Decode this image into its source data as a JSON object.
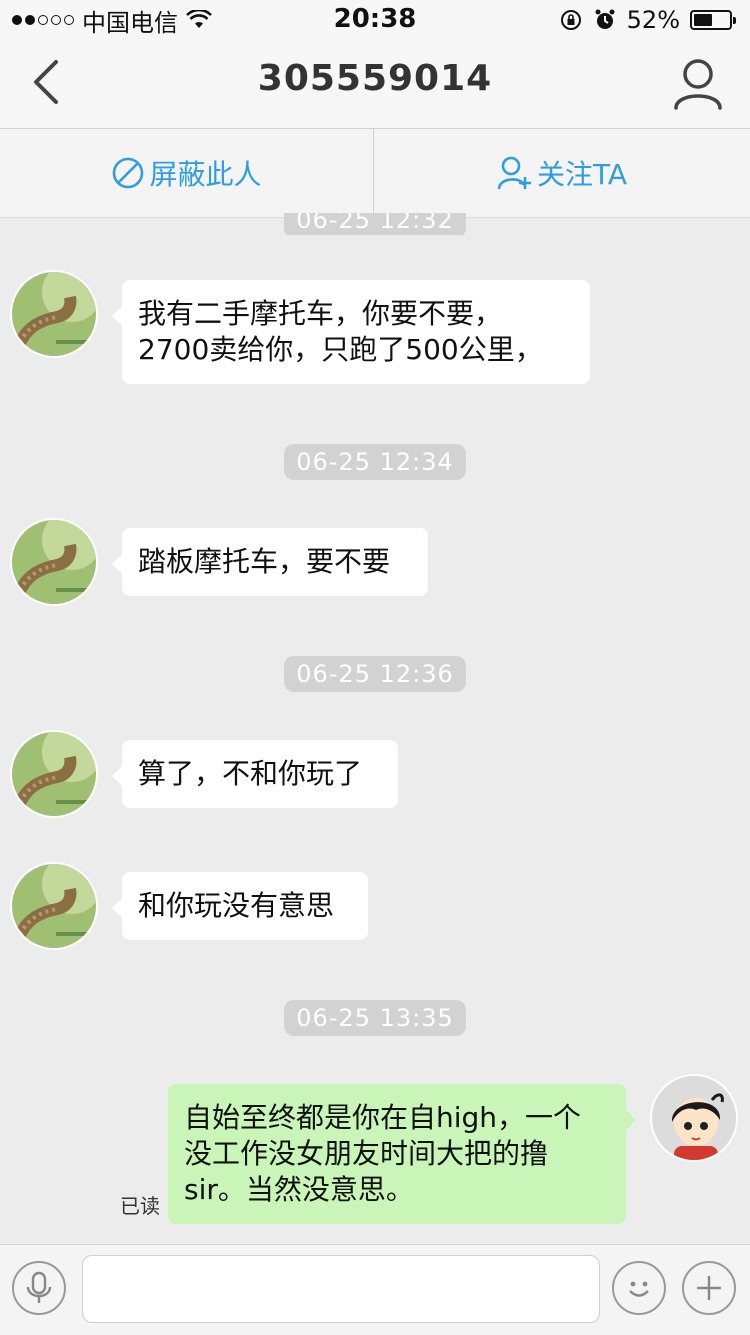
{
  "status_bar": {
    "carrier": "中国电信",
    "time": "20:38",
    "battery": "52%",
    "battery_level": 0.52
  },
  "nav": {
    "title": "305559014"
  },
  "actions": {
    "block_label": "屏蔽此人",
    "follow_label": "关注TA"
  },
  "messages": [
    {
      "type": "timestamp",
      "text": "06-25 12:32"
    },
    {
      "type": "incoming",
      "lines": [
        "我有二手摩托车，你要不要，",
        "2700卖给你，只跑了500公里，"
      ]
    },
    {
      "type": "timestamp",
      "text": "06-25 12:34"
    },
    {
      "type": "incoming",
      "lines": [
        "踏板摩托车，要不要"
      ]
    },
    {
      "type": "timestamp",
      "text": "06-25 12:36"
    },
    {
      "type": "incoming",
      "lines": [
        "算了，不和你玩了"
      ]
    },
    {
      "type": "incoming",
      "lines": [
        "和你玩没有意思"
      ]
    },
    {
      "type": "timestamp",
      "text": "06-25 13:35"
    },
    {
      "type": "outgoing",
      "lines": [
        "自始至终都是你在自high，一个",
        "没工作没女朋友时间大把的撸",
        "sir。当然没意思。"
      ],
      "status": "已读"
    }
  ],
  "icons": {
    "back": "chevron-left-icon",
    "profile": "person-icon",
    "block": "block-icon",
    "follow": "add-person-icon",
    "voice": "microphone-icon",
    "emoji": "smiley-icon",
    "more": "plus-icon"
  },
  "colors": {
    "accent": "#2f9ee0",
    "outgoing_bubble": "#c9f5b8",
    "incoming_bubble": "#ffffff",
    "background": "#ececec"
  }
}
